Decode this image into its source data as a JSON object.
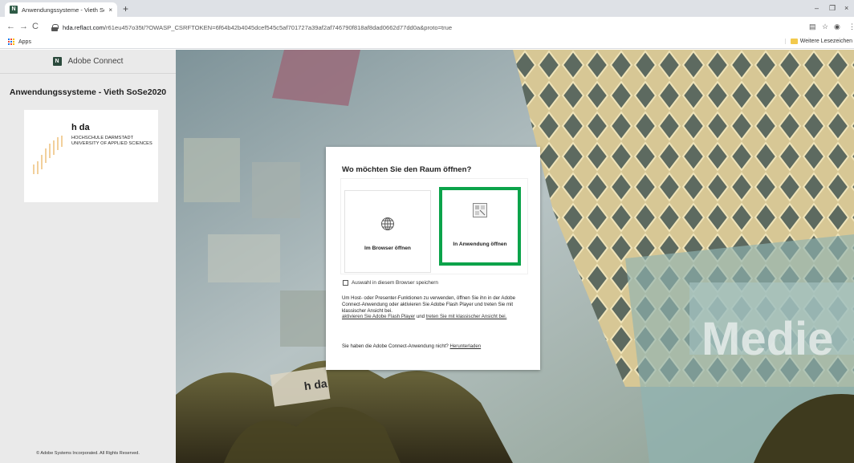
{
  "browser": {
    "tab_title": "Anwendungssysteme - Vieth SoS",
    "tab_close": "×",
    "new_tab": "+",
    "window_controls": [
      "–",
      "❐",
      "×"
    ],
    "nav": [
      "←",
      "→",
      "C"
    ],
    "url_host": "hda.reflact.com",
    "url_rest": "/r61eu457o35t/?OWASP_CSRFTOKEN=6f64b42b4045dcef545c5af701727a39af2af746790f818af8dad0662d77dd0a&proto=true",
    "bookmarks": {
      "apps_label": "Apps",
      "other_label": "Weitere Lesezeichen"
    },
    "toolbar_icons": [
      "translate-icon",
      "star-icon",
      "account-icon",
      "menu-icon"
    ]
  },
  "sidebar": {
    "brand": "Adobe Connect",
    "room_title": "Anwendungssysteme - Vieth SoSe2020",
    "logo": {
      "name": "h da",
      "line1": "HOCHSCHULE DARMSTADT",
      "line2": "UNIVERSITY OF APPLIED SCIENCES"
    },
    "copyright": "© Adobe Systems Incorporated. All Rights Reserved."
  },
  "background": {
    "sign_hda": "h da",
    "sign_media": "Medie"
  },
  "dialog": {
    "title": "Wo möchten Sie den Raum öffnen?",
    "option_browser": "Im Browser öffnen",
    "option_app": "In Anwendung öffnen",
    "remember": "Auswahl in diesem Browser speichern",
    "info_text": "Um Host- oder Presenter-Funktionen zu verwenden, öffnen Sie ihn in der Adobe Connect-Anwendung oder aktivieren Sie Adobe Flash Player und treten Sie mit klassischer Ansicht bei.",
    "link_flash": "aktivieren Sie Adobe Flash Player",
    "link_and": "und",
    "link_classic": "treten Sie mit klassischer Ansicht bei.",
    "download_prompt": "Sie haben die Adobe Connect-Anwendung nicht?",
    "download_link": "Herunterladen"
  },
  "colors": {
    "selected_border": "#0ba34a",
    "sidebar_bg": "#eaeaea"
  }
}
